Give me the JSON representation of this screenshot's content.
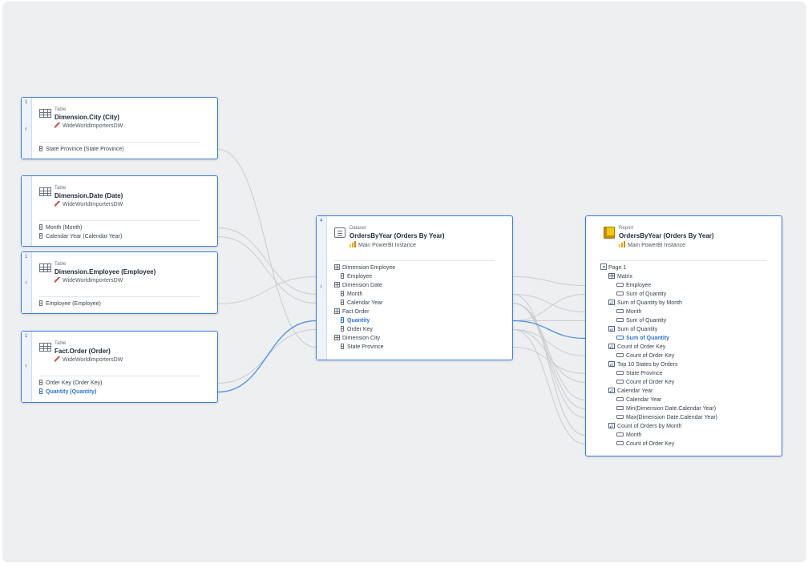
{
  "colors": {
    "canvas": "#edeff1",
    "accent": "#3b7be0",
    "highlight": "#2f73e0",
    "link": "#c9ccd1",
    "link_highlight": "#4a90e8"
  },
  "cards": {
    "city": {
      "count": "1",
      "kind": "Table",
      "title": "Dimension.City (City)",
      "source": "WideWorldImportersDW",
      "source_icon": "sql-source-icon",
      "fields": [
        {
          "label": "State Province (State Province)",
          "highlight": false
        }
      ]
    },
    "date": {
      "count": "",
      "kind": "Table",
      "title": "Dimension.Date (Date)",
      "source": "WideWorldImportersDW",
      "source_icon": "sql-source-icon",
      "fields": [
        {
          "label": "Month (Month)",
          "highlight": false
        },
        {
          "label": "Calendar Year (Calendar Year)",
          "highlight": false
        }
      ]
    },
    "employee": {
      "count": "1",
      "kind": "Table",
      "title": "Dimension.Employee (Employee)",
      "source": "WideWorldImportersDW",
      "source_icon": "sql-source-icon",
      "fields": [
        {
          "label": "Employee (Employee)",
          "highlight": false
        }
      ]
    },
    "order": {
      "count": "1",
      "kind": "Table",
      "title": "Fact.Order (Order)",
      "source": "WideWorldImportersDW",
      "source_icon": "sql-source-icon",
      "fields": [
        {
          "label": "Order Key (Order Key)",
          "highlight": false
        },
        {
          "label": "Quantity (Quantity)",
          "highlight": true
        }
      ]
    },
    "dataset": {
      "count": "4",
      "kind": "Dataset",
      "title": "OrdersByYear (Orders By Year)",
      "source": "Main PowerBI Instance",
      "source_icon": "powerbi-icon",
      "rows": [
        {
          "type": "group",
          "label": "Dimension Employee"
        },
        {
          "type": "field",
          "label": "Employee"
        },
        {
          "type": "group",
          "label": "Dimension Date"
        },
        {
          "type": "field",
          "label": "Month"
        },
        {
          "type": "field",
          "label": "Calendar Year"
        },
        {
          "type": "group",
          "label": "Fact Order"
        },
        {
          "type": "field",
          "label": "Quantity",
          "highlight": true
        },
        {
          "type": "field",
          "label": "Order Key"
        },
        {
          "type": "group",
          "label": "Dimension City"
        },
        {
          "type": "field",
          "label": "State Province"
        }
      ]
    },
    "report": {
      "kind": "Report",
      "title": "OrdersByYear (Orders By Year)",
      "source": "Main PowerBI Instance",
      "source_icon": "powerbi-icon",
      "rows": [
        {
          "type": "page",
          "label": "Page 1"
        },
        {
          "type": "matrix",
          "label": "Matrix"
        },
        {
          "type": "item",
          "label": "Employee"
        },
        {
          "type": "item",
          "label": "Sum of Quantity"
        },
        {
          "type": "visual",
          "label": "Sum of Quantity by Month"
        },
        {
          "type": "item",
          "label": "Month"
        },
        {
          "type": "item",
          "label": "Sum of Quantity"
        },
        {
          "type": "visual",
          "label": "Sum of Quantity"
        },
        {
          "type": "item",
          "label": "Sum of Quantity",
          "highlight": true
        },
        {
          "type": "visual",
          "label": "Count of Order Key"
        },
        {
          "type": "item",
          "label": "Count of Order Key"
        },
        {
          "type": "visual",
          "label": "Top 10 States by Orders"
        },
        {
          "type": "item",
          "label": "State Province"
        },
        {
          "type": "item",
          "label": "Count of Order Key"
        },
        {
          "type": "visual",
          "label": "Calendar Year"
        },
        {
          "type": "item",
          "label": "Calendar Year"
        },
        {
          "type": "item",
          "label": "Min(Dimension Date.Calendar Year)"
        },
        {
          "type": "item",
          "label": "Max(Dimension Date.Calendar Year)"
        },
        {
          "type": "visual",
          "label": "Count of Orders by Month"
        },
        {
          "type": "item",
          "label": "Month"
        },
        {
          "type": "item",
          "label": "Count of Order Key"
        }
      ]
    }
  },
  "links": [
    {
      "from": "city.0",
      "to": "dataset.9",
      "highlight": false
    },
    {
      "from": "date.0",
      "to": "dataset.3",
      "highlight": false
    },
    {
      "from": "date.1",
      "to": "dataset.4",
      "highlight": false
    },
    {
      "from": "employee.0",
      "to": "dataset.1",
      "highlight": false
    },
    {
      "from": "order.0",
      "to": "dataset.7",
      "highlight": false
    },
    {
      "from": "order.1",
      "to": "dataset.6",
      "highlight": true
    },
    {
      "from": "dataset.1",
      "to": "report.2",
      "highlight": false
    },
    {
      "from": "dataset.3",
      "to": "report.5",
      "highlight": false
    },
    {
      "from": "dataset.3",
      "to": "report.19",
      "highlight": false
    },
    {
      "from": "dataset.4",
      "to": "report.15",
      "highlight": false
    },
    {
      "from": "dataset.4",
      "to": "report.16",
      "highlight": false
    },
    {
      "from": "dataset.4",
      "to": "report.17",
      "highlight": false
    },
    {
      "from": "dataset.6",
      "to": "report.3",
      "highlight": false
    },
    {
      "from": "dataset.6",
      "to": "report.6",
      "highlight": false
    },
    {
      "from": "dataset.6",
      "to": "report.8",
      "highlight": true
    },
    {
      "from": "dataset.7",
      "to": "report.10",
      "highlight": false
    },
    {
      "from": "dataset.7",
      "to": "report.13",
      "highlight": false
    },
    {
      "from": "dataset.7",
      "to": "report.20",
      "highlight": false
    },
    {
      "from": "dataset.9",
      "to": "report.12",
      "highlight": false
    }
  ]
}
